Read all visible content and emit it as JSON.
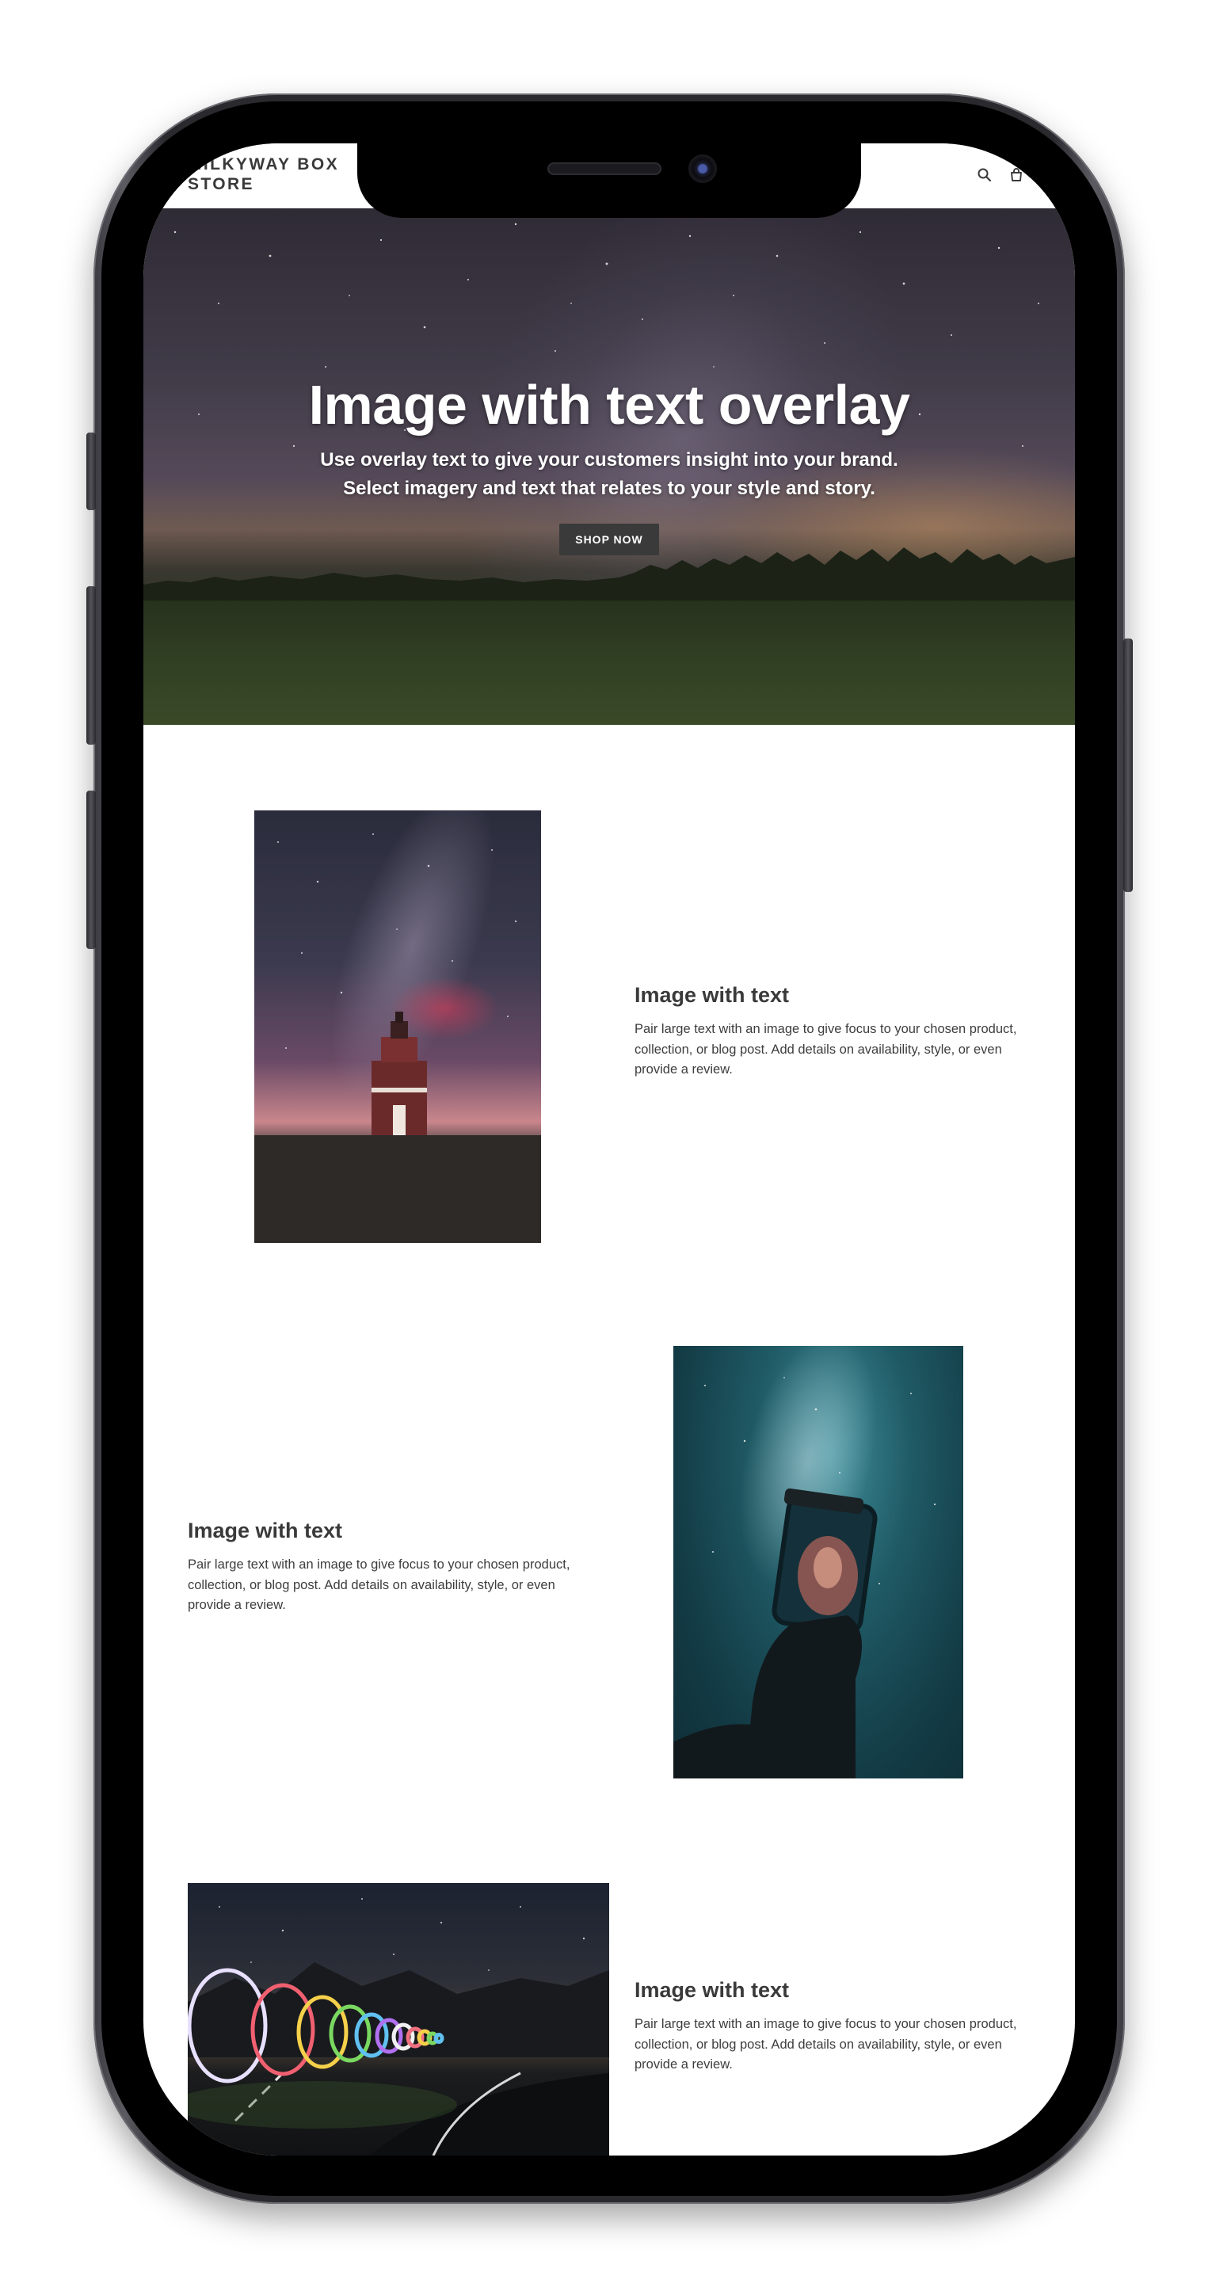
{
  "store": {
    "name": "MILKYWAY BOX STORE"
  },
  "header": {
    "icons": [
      "search-icon",
      "cart-icon"
    ]
  },
  "hero": {
    "title": "Image with text overlay",
    "subtitle": "Use overlay text to give your customers insight into your brand. Select imagery and text that relates to your style and story.",
    "button_label": "SHOP NOW"
  },
  "sections": [
    {
      "title": "Image with text",
      "body": "Pair large text with an image to give focus to your chosen product, collection, or blog post. Add details on availability, style, or even provide a review."
    },
    {
      "title": "Image with text",
      "body": "Pair large text with an image to give focus to your chosen product, collection, or blog post. Add details on availability, style, or even provide a review."
    },
    {
      "title": "Image with text",
      "body": "Pair large text with an image to give focus to your chosen product, collection, or blog post. Add details on availability, style, or even provide a review."
    }
  ],
  "colors": {
    "text": "#3a3a3a",
    "button_bg": "#3a3a3a",
    "background": "#ffffff",
    "phone_frame": "#2a292e"
  }
}
